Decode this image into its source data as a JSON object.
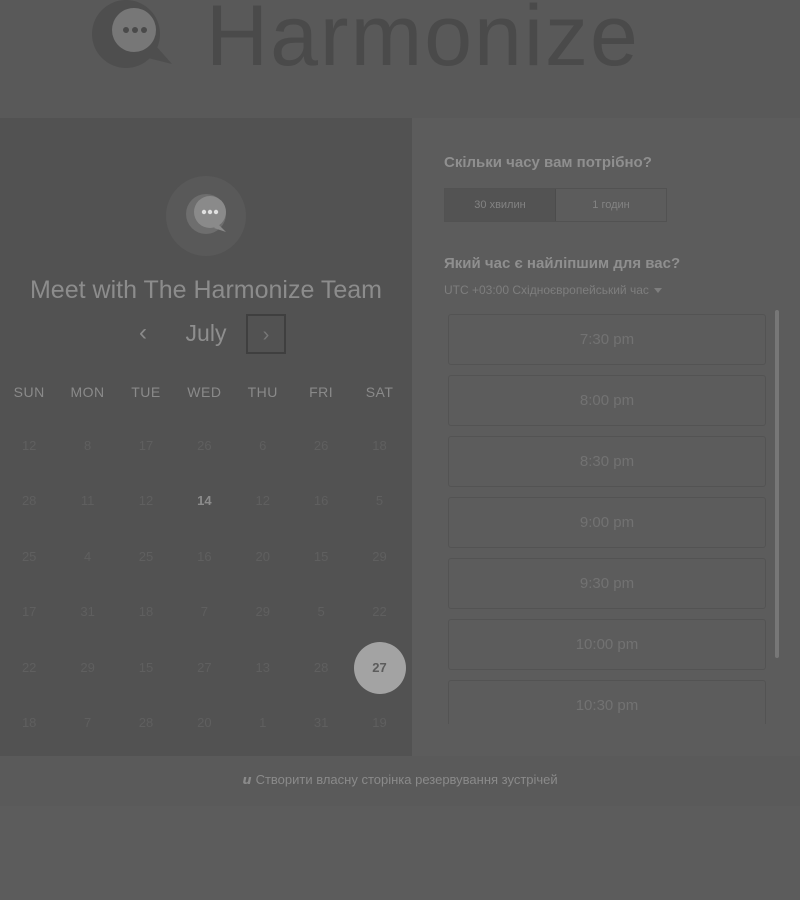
{
  "brand": {
    "name": "Harmonize",
    "logo_icon": "chat-bubble-logo-icon"
  },
  "calendar": {
    "meeting_title": "Meet with The Harmonize Team",
    "month": "July",
    "prev_icon": "‹",
    "next_icon": "›",
    "weekdays": [
      "SUN",
      "MON",
      "TUE",
      "WED",
      "THU",
      "FRI",
      "SAT"
    ],
    "days": [
      [
        "12",
        "8",
        "17",
        "26",
        "6",
        "26",
        "18"
      ],
      [
        "28",
        "11",
        "12",
        "14",
        "12",
        "16",
        "5"
      ],
      [
        "25",
        "4",
        "25",
        "16",
        "20",
        "15",
        "29"
      ],
      [
        "17",
        "31",
        "18",
        "7",
        "29",
        "5",
        "22"
      ],
      [
        "22",
        "29",
        "15",
        "27",
        "13",
        "28",
        "27"
      ],
      [
        "18",
        "7",
        "28",
        "20",
        "1",
        "31",
        "19"
      ]
    ],
    "active_day": "14",
    "selected_day": "27"
  },
  "booking": {
    "duration_question": "Скільки часу вам потрібно?",
    "durations": [
      "30 хвилин",
      "1 годин"
    ],
    "time_question": "Який час є найліпшим для вас?",
    "timezone": "UTC +03:00 Східноєвропейський час",
    "slots": [
      "7:30 pm",
      "8:00 pm",
      "8:30 pm",
      "9:00 pm",
      "9:30 pm",
      "10:00 pm",
      "10:30 pm"
    ]
  },
  "footer": {
    "link": "Створити власну сторінка резервування зустрічей",
    "icon": "hubspot-sprocket-icon"
  },
  "colors": {
    "background": "#5c5c5c",
    "selected_day": "#a3a3a3"
  }
}
